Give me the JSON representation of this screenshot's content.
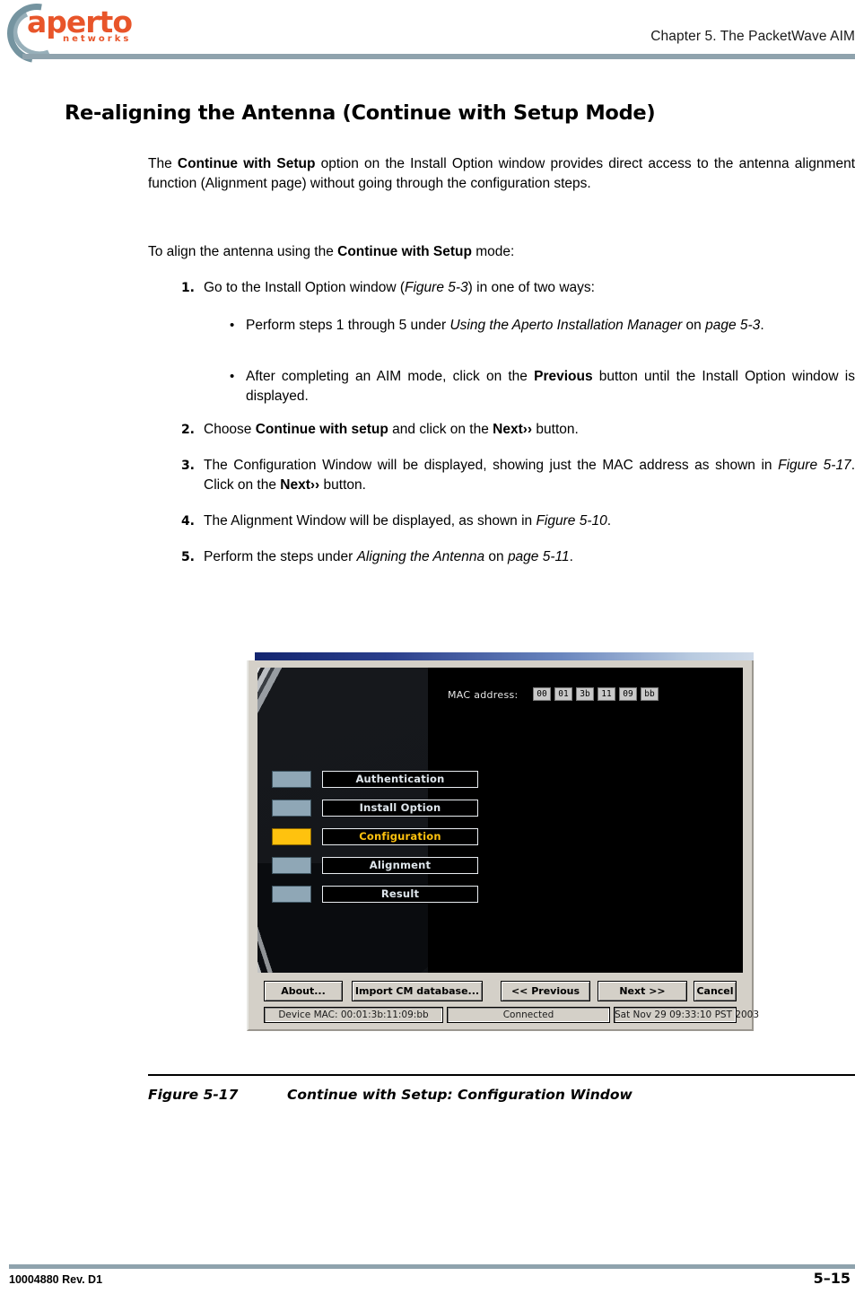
{
  "header": {
    "logo_word": "aperto",
    "logo_sub": "networks",
    "chapter_title": "Chapter 5.  The PacketWave AIM"
  },
  "section": {
    "heading": "Re-aligning the Antenna (Continue with Setup Mode)"
  },
  "body": {
    "intro_para": "The Continue with Setup option on the Install Option window provides direct access to the antenna alignment function (Alignment page) without going through the configuration steps.",
    "lead_in": "To align the antenna using the Continue with Setup mode:",
    "items": [
      {
        "num": "1.",
        "text": "Go to the Install Option window (Figure 5-3) in one of two ways:"
      },
      {
        "num": "2.",
        "text": "Choose Continue with setup and click on the Next›› button."
      },
      {
        "num": "3.",
        "text": "The Configuration Window will be displayed, showing just the MAC address as shown in Figure 5-17. Click on the Next›› button."
      },
      {
        "num": "4.",
        "text": "The Alignment Window will be displayed, as shown in Figure 5-10."
      },
      {
        "num": "5.",
        "text": "Perform the steps under Aligning the Antenna on page 5-11."
      }
    ],
    "bullets": [
      {
        "dot": "•",
        "text": "Perform steps 1 through 5 under Using the Aperto Installation Manager on page 5-3."
      },
      {
        "dot": "•",
        "text": "After completing an AIM mode, click on the Previous button until the Install Option window is displayed."
      }
    ]
  },
  "figure": {
    "caption_label": "Figure 5-17",
    "caption_text": "Continue with Setup: Configuration Window",
    "window": {
      "nav_items": [
        {
          "label": "Authentication",
          "active": false
        },
        {
          "label": "Install Option",
          "active": false
        },
        {
          "label": "Configuration",
          "active": true
        },
        {
          "label": "Alignment",
          "active": false
        },
        {
          "label": "Result",
          "active": false
        }
      ],
      "mac_label": "MAC address:",
      "mac_octets": [
        "00",
        "01",
        "3b",
        "11",
        "09",
        "bb"
      ],
      "buttons": [
        {
          "label": "About..."
        },
        {
          "label": "Import CM database..."
        },
        {
          "label": "<< Previous"
        },
        {
          "label": "Next >>"
        },
        {
          "label": "Cancel"
        }
      ],
      "status": {
        "device_mac": "Device MAC: 00:01:3b:11:09:bb",
        "connection": "Connected",
        "timestamp": "Sat Nov 29 09:33:10 PST 2003"
      }
    }
  },
  "footer": {
    "doc_id": "10004880 Rev. D1",
    "page_number": "5–15"
  },
  "colors": {
    "brand_orange": "#e8552a",
    "rule_blue_gray": "#8fa3ad",
    "active_nav": "#ffc20e",
    "nav_chip": "#8fa7b6",
    "window_face": "#d4d0c8"
  }
}
